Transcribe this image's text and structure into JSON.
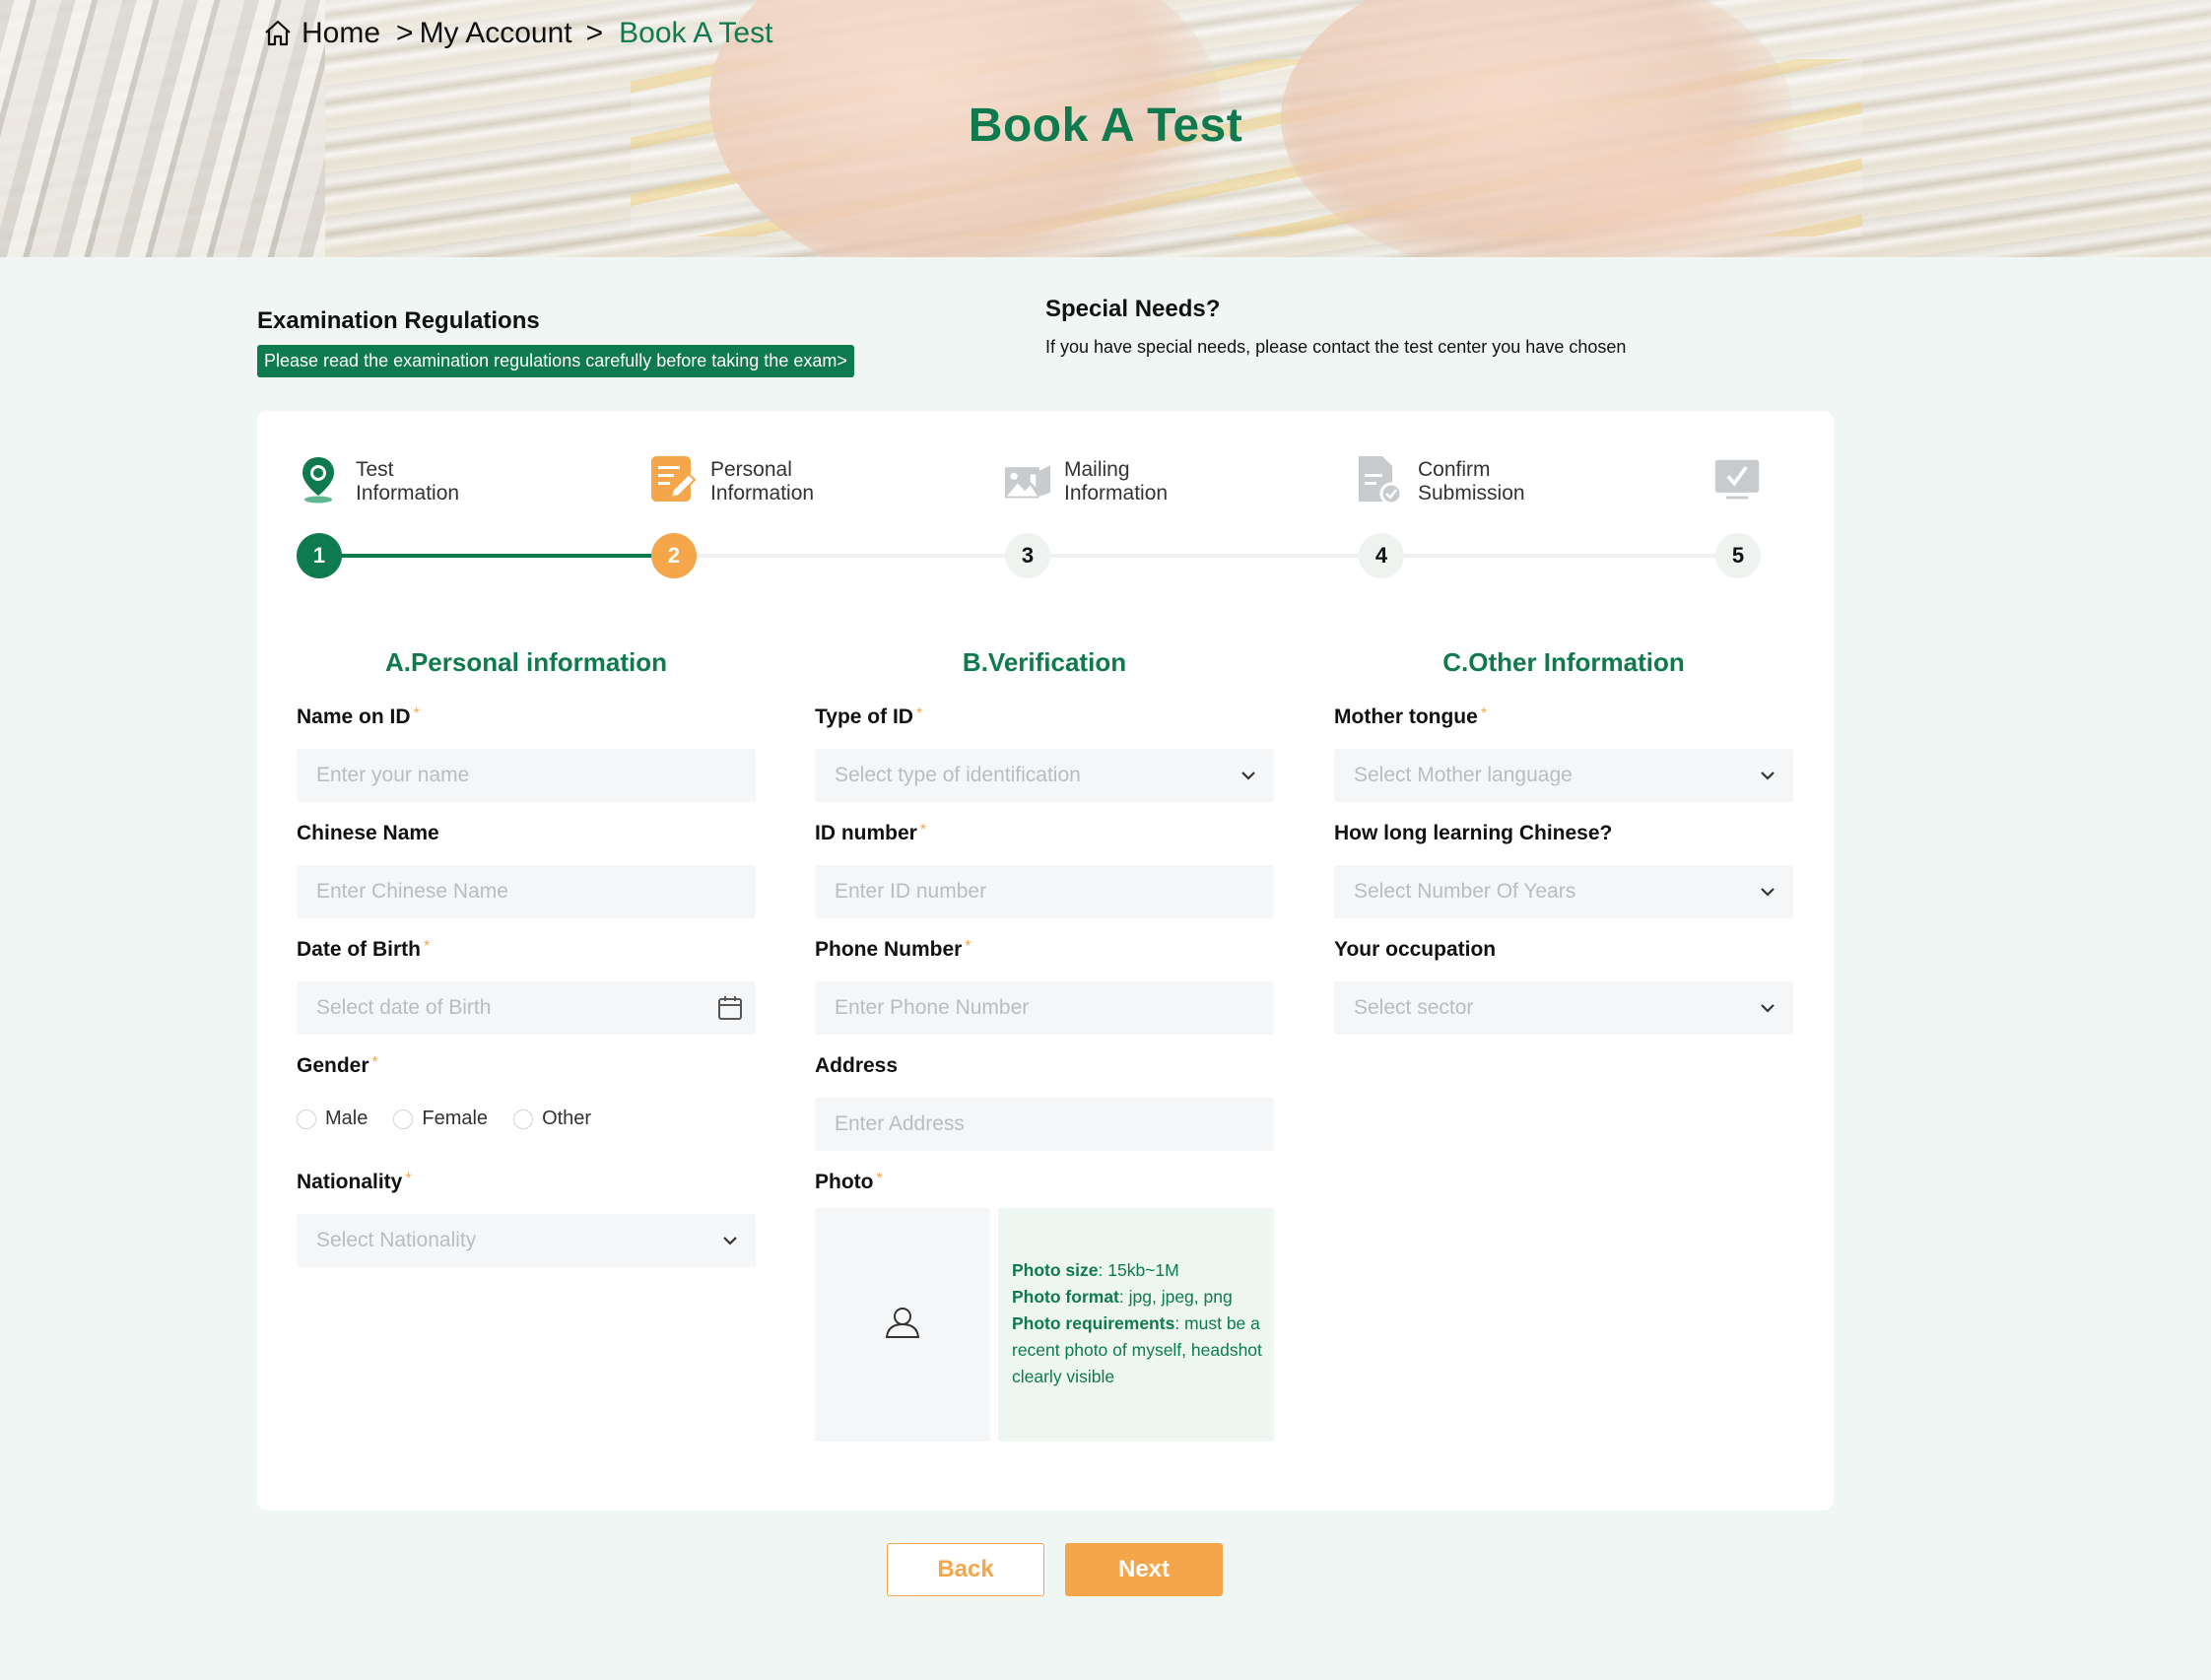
{
  "breadcrumb": {
    "home": "Home",
    "sep1": ">",
    "account": "My Account",
    "sep2": ">",
    "current": "Book A Test"
  },
  "page_title": "Book A Test",
  "exam_regulations": {
    "title": "Examination Regulations",
    "link": "Please read the examination regulations carefully before taking the exam>"
  },
  "special_needs": {
    "title": "Special Needs?",
    "text": "If you have special needs, please contact the test center you have chosen"
  },
  "steps": [
    {
      "line1": "Test",
      "line2": "Information",
      "number": "1",
      "state": "done",
      "icon": "map-pin-icon"
    },
    {
      "line1": "Personal",
      "line2": "Information",
      "number": "2",
      "state": "active",
      "icon": "edit-document-icon"
    },
    {
      "line1": "Mailing",
      "line2": "Information",
      "number": "3",
      "state": "pending",
      "icon": "image-icon"
    },
    {
      "line1": "Confirm",
      "line2": "Submission",
      "number": "4",
      "state": "pending",
      "icon": "document-check-icon"
    },
    {
      "line1": "",
      "line2": "",
      "number": "5",
      "state": "pending",
      "icon": "monitor-check-icon"
    }
  ],
  "sections": {
    "a": "A.Personal information",
    "b": "B.Verification",
    "c": "C.Other Information"
  },
  "fields": {
    "name_on_id": {
      "label": "Name on ID",
      "placeholder": "Enter your name"
    },
    "chinese_name": {
      "label": "Chinese Name",
      "placeholder": "Enter Chinese Name"
    },
    "dob": {
      "label": "Date of Birth",
      "placeholder": "Select date of Birth"
    },
    "gender": {
      "label": "Gender",
      "options": [
        "Male",
        "Female",
        "Other"
      ]
    },
    "nationality": {
      "label": "Nationality",
      "placeholder": "Select Nationality"
    },
    "id_type": {
      "label": "Type of ID",
      "placeholder": "Select type of identification"
    },
    "id_number": {
      "label": "ID number",
      "placeholder": "Enter ID number"
    },
    "phone": {
      "label": "Phone Number",
      "placeholder": "Enter Phone Number"
    },
    "address": {
      "label": "Address",
      "placeholder": "Enter Address"
    },
    "photo": {
      "label": "Photo"
    },
    "mother_tongue": {
      "label": "Mother tongue",
      "placeholder": "Select Mother language"
    },
    "learning_years": {
      "label": "How long learning Chinese?",
      "placeholder": "Select Number Of Years"
    },
    "occupation": {
      "label": "Your occupation",
      "placeholder": "Select sector"
    }
  },
  "required_mark": "*",
  "photo_note": {
    "size_label": "Photo size",
    "size_value": ": 15kb~1M",
    "format_label": "Photo format",
    "format_value": ": jpg, jpeg, png",
    "req_label": "Photo requirements",
    "req_value": ": must be a recent photo of myself, headshot clearly visible"
  },
  "buttons": {
    "back": "Back",
    "next": "Next"
  },
  "colors": {
    "brand_green": "#0e7a4e",
    "accent_orange": "#f5a64a",
    "page_bg": "#f0f6f3"
  }
}
